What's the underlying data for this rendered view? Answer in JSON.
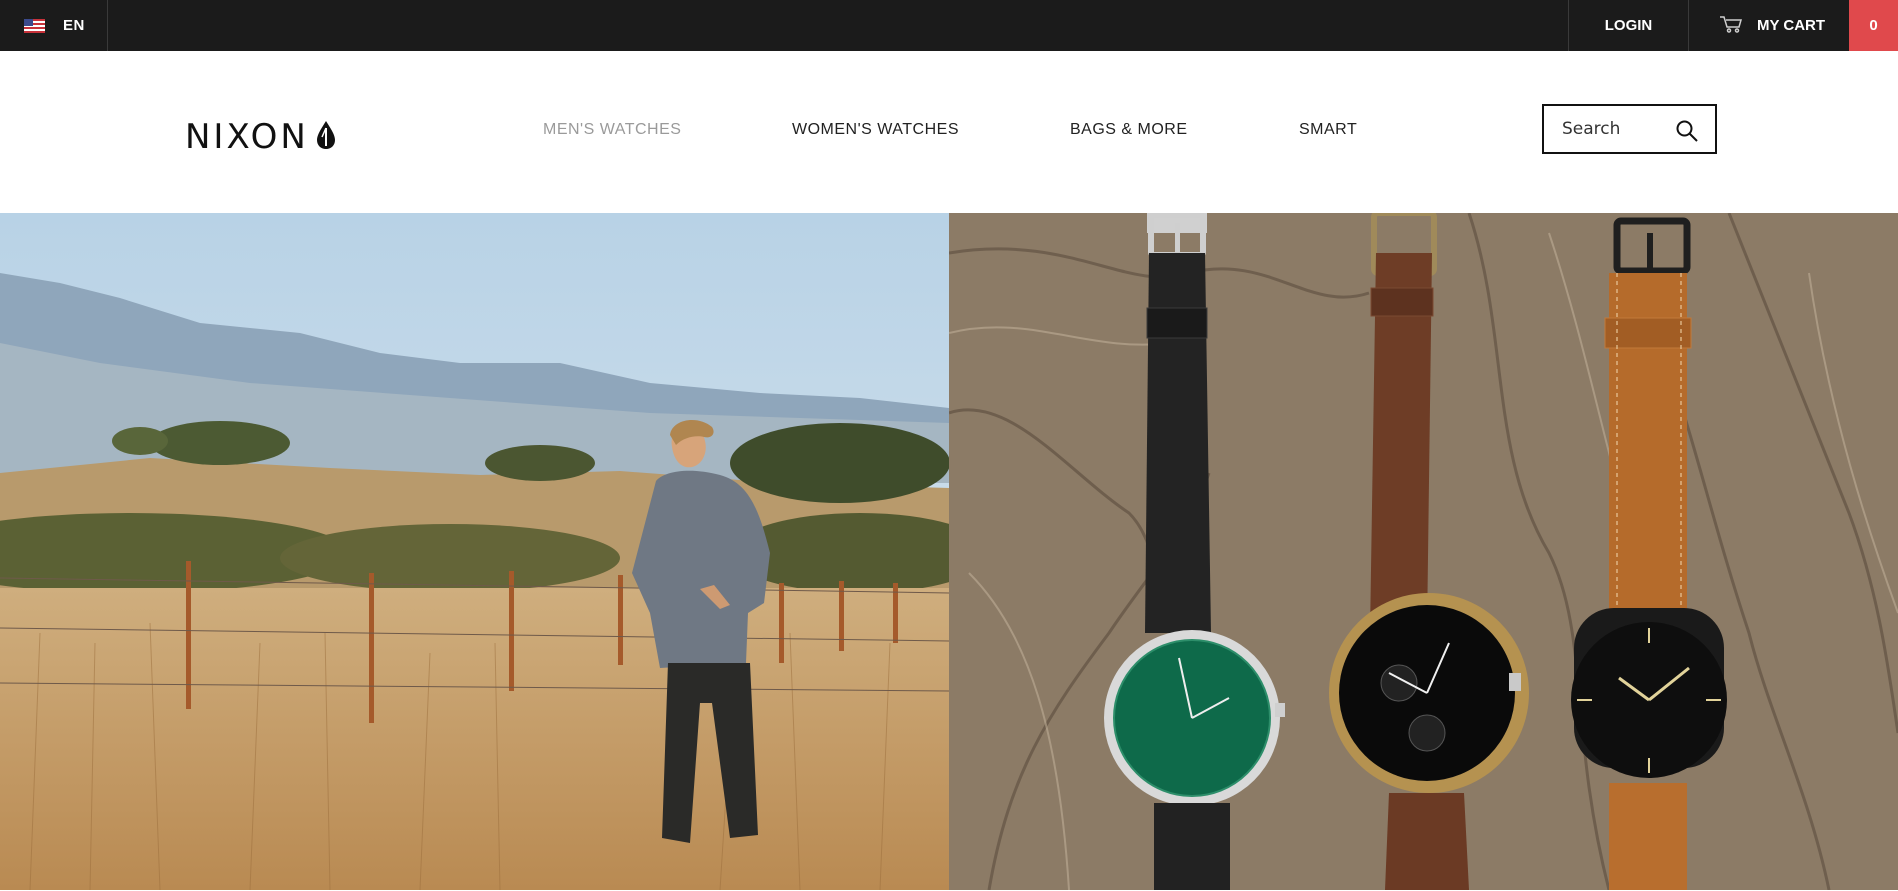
{
  "topbar": {
    "language": "EN",
    "login_label": "LOGIN",
    "cart_label": "MY CART",
    "cart_count": "0"
  },
  "header": {
    "logo_text": "NIXON",
    "nav": [
      {
        "label": "MEN'S WATCHES",
        "active": true
      },
      {
        "label": "WOMEN'S WATCHES",
        "active": false
      },
      {
        "label": "BAGS & MORE",
        "active": false
      },
      {
        "label": "SMART",
        "active": false
      }
    ],
    "search": {
      "placeholder": "Search",
      "value": ""
    }
  },
  "icons": {
    "flag": "us-flag-icon",
    "cart": "cart-icon",
    "search": "search-icon",
    "logo_mark": "nixon-logo-mark-icon"
  },
  "colors": {
    "topbar_bg": "#1b1b1b",
    "cart_badge": "#e0494c",
    "nav_active": "#9a9a9a",
    "text": "#222222"
  },
  "hero": {
    "left_image": "man-in-golden-field",
    "right_image": "three-leather-watches-on-wood"
  }
}
